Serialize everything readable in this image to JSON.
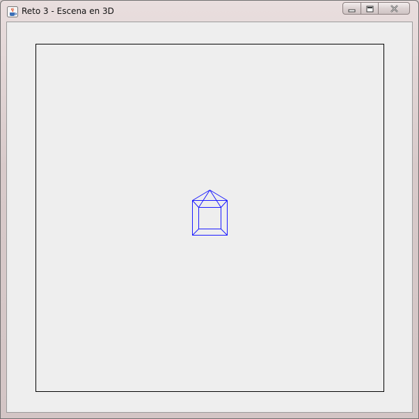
{
  "window": {
    "title": "Reto 3 - Escena en 3D",
    "app_icon": "java-cup-icon"
  },
  "caption_buttons": {
    "minimize_icon": "minimize-icon",
    "maximize_icon": "maximize-icon",
    "close_icon": "close-icon"
  },
  "scene": {
    "object": "wireframe house",
    "line_color": "#1a1aff",
    "frame_color": "#000000",
    "background_color": "#eeeeee"
  }
}
